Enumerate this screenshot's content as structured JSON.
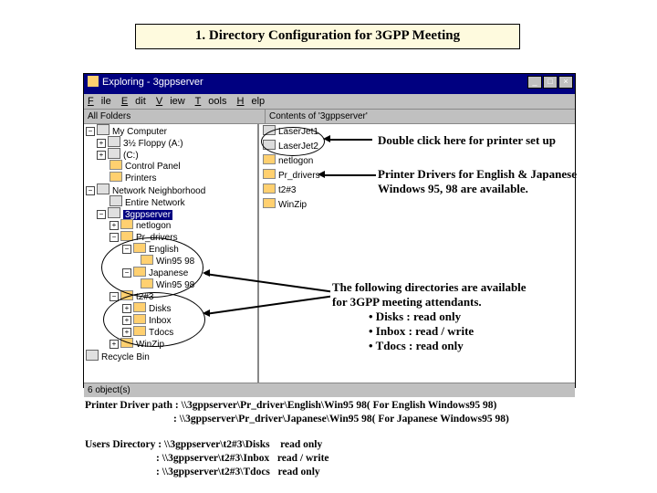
{
  "title": "1. Directory Configuration for 3GPP Meeting",
  "winTitle": "Exploring - 3gppserver",
  "menu": {
    "m1": "File",
    "m2": "Edit",
    "m3": "View",
    "m4": "Tools",
    "m5": "Help"
  },
  "leftLabel": "All Folders",
  "rightLabel": "Contents of '3gppserver'",
  "L": {
    "r1": "My Computer",
    "r2": "3½ Floppy (A:)",
    "r3": "(C:)",
    "r4": "Control Panel",
    "r5": "Printers",
    "r6": "Network Neighborhood",
    "r7": "Entire Network",
    "r8": "3gppserver",
    "r9": "netlogon",
    "r10": "Pr_drivers",
    "r11": "English",
    "r12": "Win95 98",
    "r13": "Japanese",
    "r14": "Win95 98",
    "r15": "t2#3",
    "r16": "Disks",
    "r17": "Inbox",
    "r18": "Tdocs",
    "r19": "WinZip",
    "r20": "Recycle Bin"
  },
  "R": {
    "r1": "LaserJet1",
    "r2": "LaserJet2",
    "r3": "netlogon",
    "r4": "Pr_drivers",
    "r5": "t2#3",
    "r6": "WinZip"
  },
  "status": "6 object(s)",
  "an1": "Double click here for printer set up",
  "an2a": "Printer Drivers for English & Japanese",
  "an2b": "Windows 95, 98 are available.",
  "blk": {
    "h": "The following directories are available",
    "s": "for 3GPP meeting attendants.",
    "b1": "• Disks  : read only",
    "b2": "• Inbox : read / write",
    "b3": "• Tdocs : read only"
  },
  "f1a": "Printer Driver path : \\\\3gppserver\\Pr_driver\\English\\Win95 98( For English Windows95 98)",
  "f1b": ": \\\\3gppserver\\Pr_driver\\Japanese\\Win95 98( For Japanese Windows95 98)",
  "f2a": "Users Directory : \\\\3gppserver\\t2#3\\Disks",
  "f2b": ": \\\\3gppserver\\t2#3\\Inbox",
  "f2c": ": \\\\3gppserver\\t2#3\\Tdocs",
  "f2ar": "read only",
  "f2br": "read / write",
  "f2cr": "read only"
}
